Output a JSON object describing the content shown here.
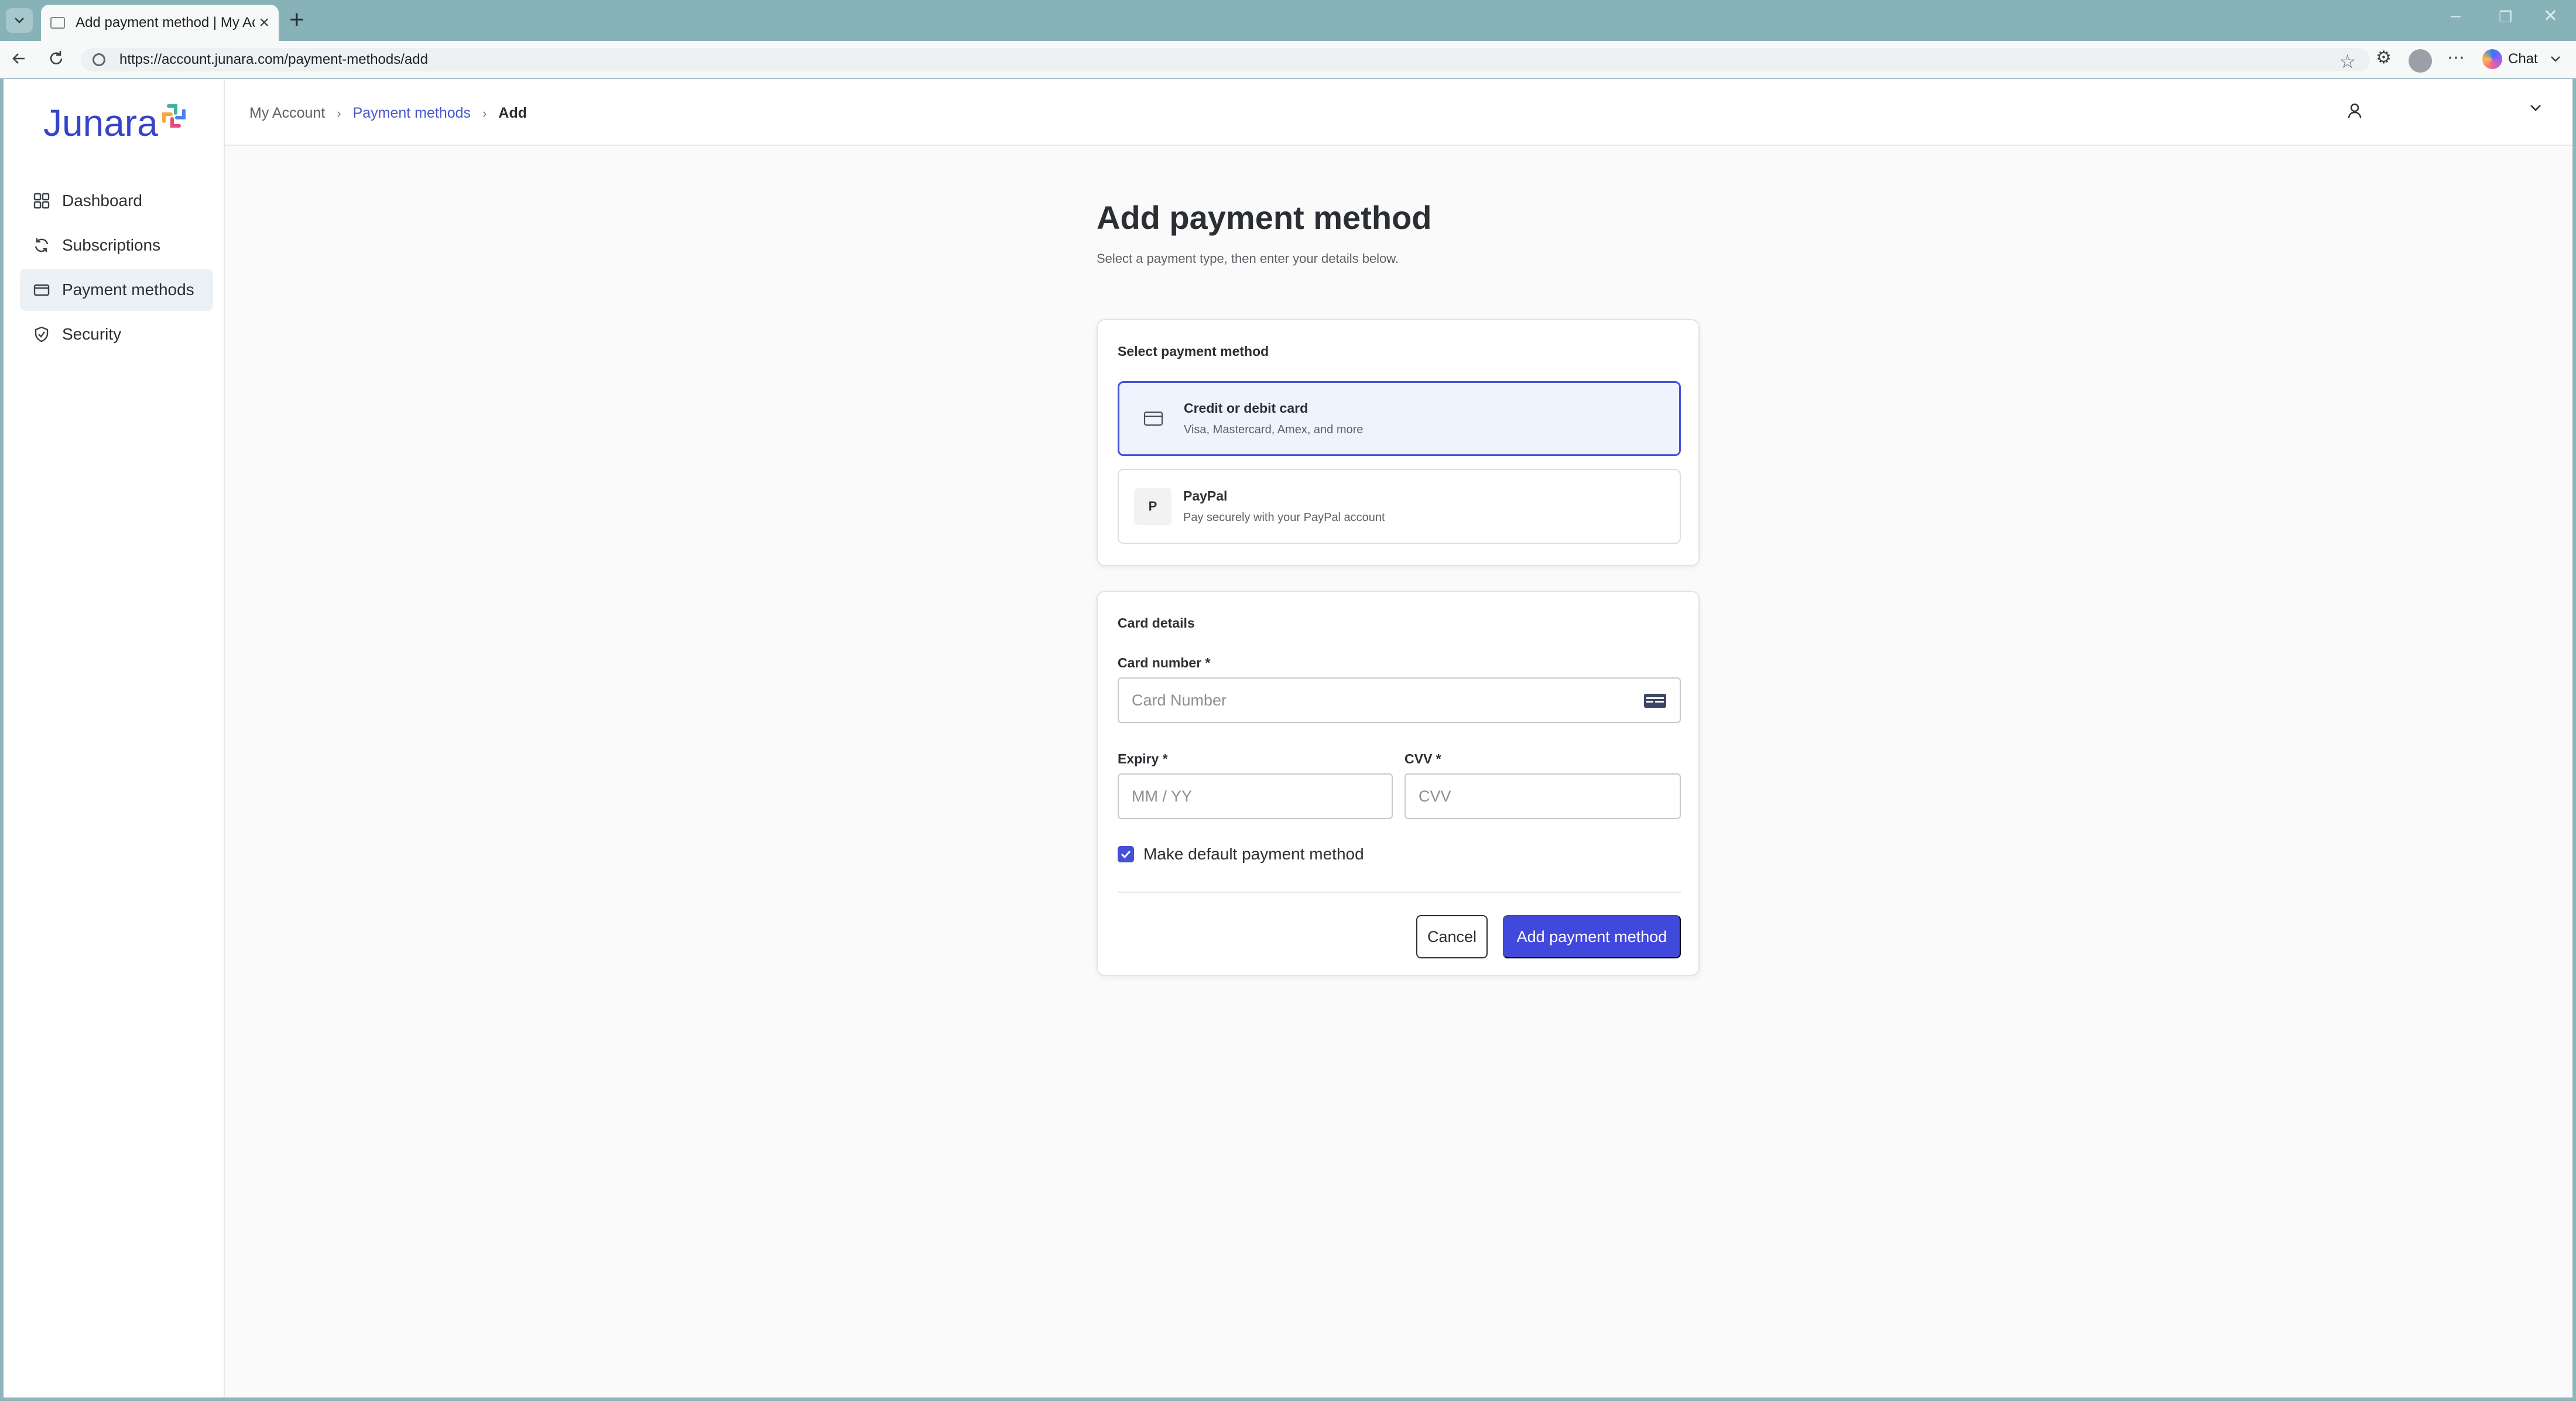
{
  "browser": {
    "tab_title": "Add payment method | My Account",
    "url": "https://account.junara.com/payment-methods/add",
    "chat_label": "Chat"
  },
  "sidebar": {
    "logo": "Junara",
    "items": [
      {
        "label": "Dashboard",
        "icon": "grid-icon"
      },
      {
        "label": "Subscriptions",
        "icon": "refresh-icon"
      },
      {
        "label": "Payment methods",
        "icon": "credit-card-icon",
        "active": true
      },
      {
        "label": "Security",
        "icon": "shield-check-icon"
      }
    ]
  },
  "breadcrumb": {
    "items": [
      "My Account",
      "Payment methods",
      "Add"
    ]
  },
  "page": {
    "title": "Add payment method",
    "subtitle": "Select a payment type, then enter your details below."
  },
  "select_method": {
    "heading": "Select payment method",
    "options": [
      {
        "title": "Credit or debit card",
        "description": "Visa, Mastercard, Amex, and more",
        "icon": "credit-card-icon",
        "selected": true
      },
      {
        "title": "PayPal",
        "description": "Pay securely with your PayPal account",
        "icon_text": "P",
        "selected": false
      }
    ]
  },
  "card_details": {
    "heading": "Card details",
    "card_number_label": "Card number *",
    "card_number_placeholder": "Card Number",
    "expiry_label": "Expiry *",
    "expiry_placeholder": "MM / YY",
    "cvv_label": "CVV *",
    "cvv_placeholder": "CVV",
    "default_label": "Make default payment method",
    "default_checked": true,
    "cancel_label": "Cancel",
    "submit_label": "Add payment method"
  },
  "colors": {
    "brand": "#3545c9",
    "accent": "#4149dc",
    "selected_bg": "#eef4fe"
  }
}
